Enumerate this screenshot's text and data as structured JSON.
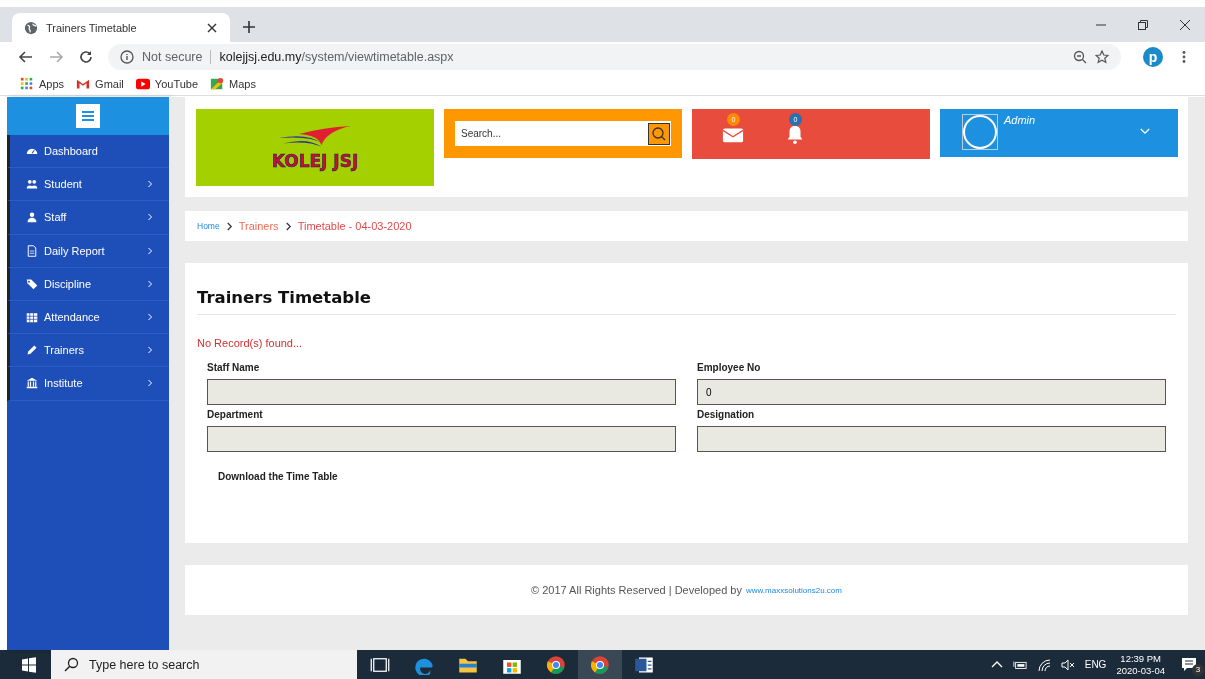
{
  "browser": {
    "tab_title": "Trainers Timetable",
    "security": "Not secure",
    "url_host": "kolejjsj.edu.my",
    "url_path": "/system/viewtimetable.aspx",
    "profile": "p",
    "bookmarks": [
      {
        "kind": "apps",
        "label": "Apps"
      },
      {
        "kind": "mail",
        "label": "Gmail"
      },
      {
        "kind": "video",
        "label": "YouTube"
      },
      {
        "kind": "map",
        "label": "Maps"
      }
    ]
  },
  "sidebar": {
    "items": [
      {
        "kind": "dashboard",
        "label": "Dashboard",
        "expandable": false
      },
      {
        "kind": "users",
        "label": "Student",
        "expandable": true
      },
      {
        "kind": "user",
        "label": "Staff",
        "expandable": true
      },
      {
        "kind": "report",
        "label": "Daily Report",
        "expandable": true
      },
      {
        "kind": "tag",
        "label": "Discipline",
        "expandable": true
      },
      {
        "kind": "calendar",
        "label": "Attendance",
        "expandable": true
      },
      {
        "kind": "pencil",
        "label": "Trainers",
        "expandable": true
      },
      {
        "kind": "bank",
        "label": "Institute",
        "expandable": true
      }
    ]
  },
  "header": {
    "logo_text": "KOLEJ JSJ",
    "search": {
      "placeholder": "Search..."
    },
    "mail_count": "0",
    "alert_count": "0",
    "user": "Admin"
  },
  "breadcrumb": [
    {
      "kind": "home",
      "label": "Home"
    },
    {
      "kind": "link",
      "label": "Trainers"
    },
    {
      "kind": "current",
      "label": "Timetable - 04-03-2020"
    }
  ],
  "panel": {
    "title": "Trainers Timetable",
    "message": "No Record(s) found...",
    "fields": [
      {
        "label": "Staff Name"
      },
      {
        "label": "Employee No",
        "value": "0"
      },
      {
        "label": "Department"
      },
      {
        "label": "Designation"
      }
    ],
    "download": "Download the Time Table"
  },
  "footer": {
    "text": "© 2017 All Rights Reserved | Developed by",
    "link": "www.maxxsolutions2u.com"
  },
  "taskbar": {
    "search": {
      "placeholder": "Type here to search"
    },
    "apps": [
      {
        "kind": "taskview",
        "selected": false
      },
      {
        "kind": "edge",
        "selected": false
      },
      {
        "kind": "folder",
        "selected": false
      },
      {
        "kind": "store",
        "selected": false
      },
      {
        "kind": "chrome",
        "selected": false
      },
      {
        "kind": "chrome",
        "selected": true
      },
      {
        "kind": "word",
        "selected": false
      }
    ],
    "language": "ENG",
    "time": "12:39 PM",
    "date": "2020-03-04",
    "notifications": "3"
  }
}
